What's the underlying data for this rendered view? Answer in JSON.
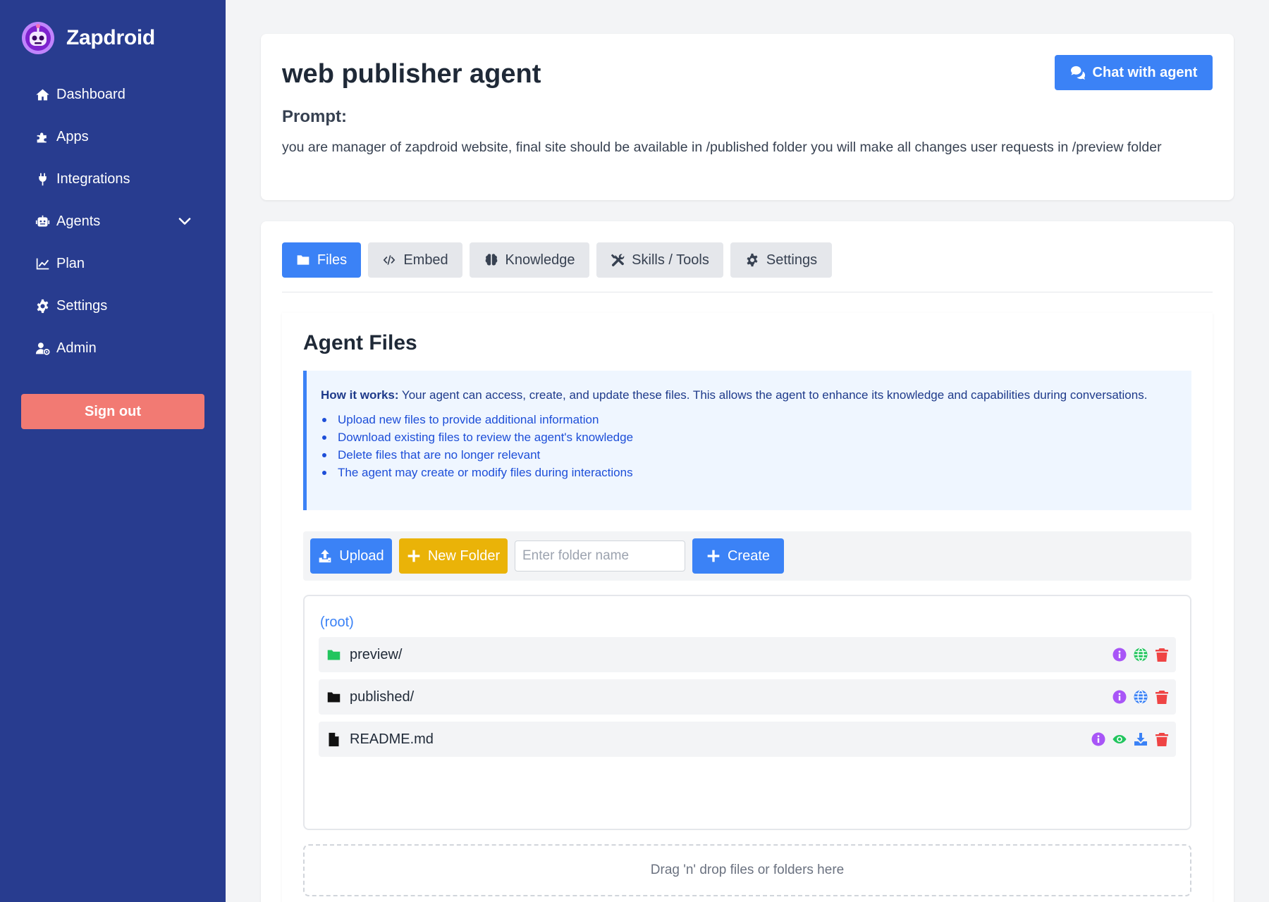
{
  "sidebar": {
    "brand": "Zapdroid",
    "items": [
      {
        "label": "Dashboard",
        "icon": "home-icon"
      },
      {
        "label": "Apps",
        "icon": "puzzle-icon"
      },
      {
        "label": "Integrations",
        "icon": "plug-icon"
      },
      {
        "label": "Agents",
        "icon": "robot-icon"
      },
      {
        "label": "Plan",
        "icon": "chart-line-icon"
      },
      {
        "label": "Settings",
        "icon": "gear-icon"
      },
      {
        "label": "Admin",
        "icon": "user-gear-icon"
      }
    ],
    "signout_label": "Sign out"
  },
  "header": {
    "title": "web publisher agent",
    "chat_label": "Chat with agent",
    "prompt_label": "Prompt:",
    "prompt_text": "you are manager of zapdroid website, final site should be available in /published folder you will make all changes user requests in /preview folder"
  },
  "tabs": [
    {
      "label": "Files",
      "icon": "folder-icon",
      "active": true
    },
    {
      "label": "Embed",
      "icon": "code-icon",
      "active": false
    },
    {
      "label": "Knowledge",
      "icon": "brain-icon",
      "active": false
    },
    {
      "label": "Skills / Tools",
      "icon": "tools-icon",
      "active": false
    },
    {
      "label": "Settings",
      "icon": "gear-icon",
      "active": false
    }
  ],
  "files": {
    "title": "Agent Files",
    "info": {
      "lead": "How it works:",
      "text": " Your agent can access, create, and update these files. This allows the agent to enhance its knowledge and capabilities during conversations.",
      "bullets": [
        "Upload new files to provide additional information",
        "Download existing files to review the agent's knowledge",
        "Delete files that are no longer relevant",
        "The agent may create or modify files during interactions"
      ]
    },
    "toolbar": {
      "upload_label": "Upload",
      "new_folder_label": "New Folder",
      "folder_placeholder": "Enter folder name",
      "create_label": "Create"
    },
    "root_label": "(root)",
    "rows": [
      {
        "name": "preview/",
        "type": "folder",
        "icon": "folder-icon",
        "icon_color": "#22c55e",
        "globe_color": "#22c55e"
      },
      {
        "name": "published/",
        "type": "folder",
        "icon": "folder-icon",
        "icon_color": "#111111",
        "globe_color": "#3b82f6"
      },
      {
        "name": "README.md",
        "type": "file",
        "icon": "file-icon",
        "icon_color": "#111111"
      }
    ],
    "dropzone_label": "Drag 'n' drop files or folders here"
  },
  "colors": {
    "sidebar_bg": "#283c8f",
    "accent": "#3b82f6",
    "signout": "#f27a73",
    "new_folder": "#eab308",
    "info_icon": "#a855f7",
    "delete_icon": "#ef4444",
    "view_icon": "#22c55e"
  }
}
